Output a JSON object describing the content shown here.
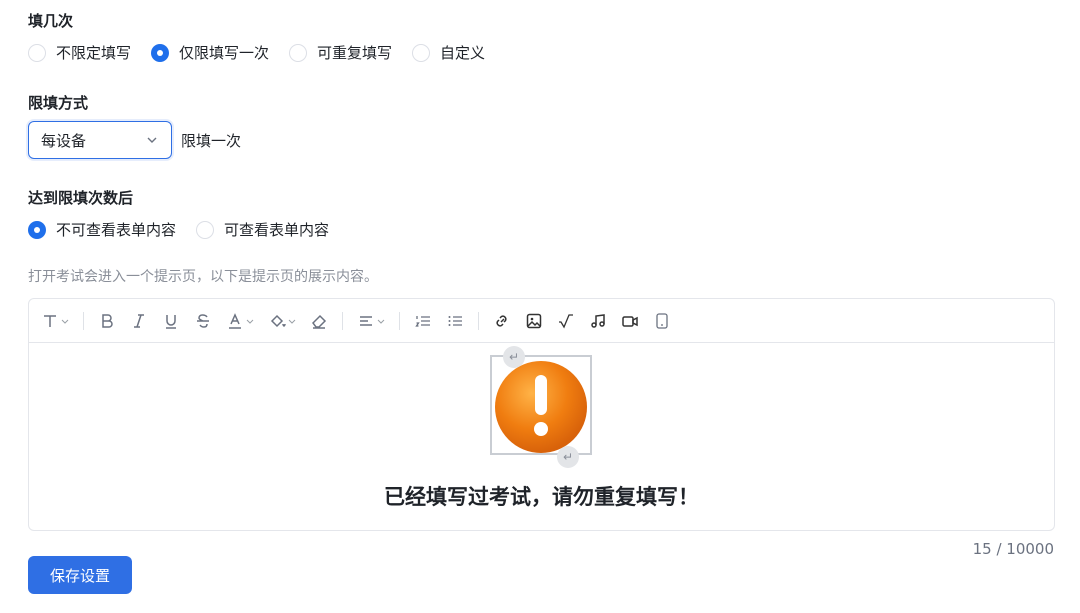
{
  "fill_count": {
    "title": "填几次",
    "options": [
      {
        "label": "不限定填写",
        "checked": false
      },
      {
        "label": "仅限填写一次",
        "checked": true
      },
      {
        "label": "可重复填写",
        "checked": false
      },
      {
        "label": "自定义",
        "checked": false
      }
    ]
  },
  "limit_method": {
    "title": "限填方式",
    "select_value": "每设备",
    "side_text": "限填一次"
  },
  "after_limit": {
    "title": "达到限填次数后",
    "options": [
      {
        "label": "不可查看表单内容",
        "checked": true
      },
      {
        "label": "可查看表单内容",
        "checked": false
      }
    ]
  },
  "hint": "打开考试会进入一个提示页，以下是提示页的展示内容。",
  "editor": {
    "content_text": "已经填写过考试，请勿重复填写！",
    "counter": "15 / 10000",
    "image_accent": "#f07d10"
  },
  "save_button": "保存设置",
  "colors": {
    "primary": "#2f6fe4",
    "border": "#e4e6eb"
  }
}
